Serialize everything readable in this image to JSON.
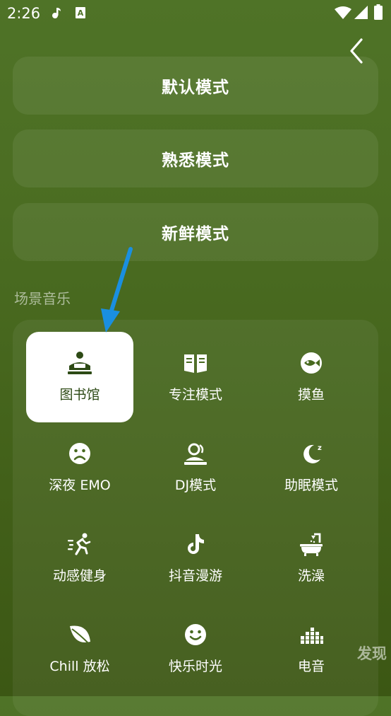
{
  "status_bar": {
    "time": "2:26",
    "icons": [
      "music-note-icon",
      "a-notification-icon",
      "wifi-icon",
      "signal-icon",
      "battery-icon"
    ]
  },
  "header": {
    "back_icon": "chevron-left-icon"
  },
  "modes": [
    {
      "label": "默认模式"
    },
    {
      "label": "熟悉模式"
    },
    {
      "label": "新鲜模式"
    }
  ],
  "section_title": "场景音乐",
  "scenes": [
    {
      "label": "图书馆",
      "icon": "library-icon",
      "selected": true
    },
    {
      "label": "专注模式",
      "icon": "book-icon"
    },
    {
      "label": "摸鱼",
      "icon": "fish-icon"
    },
    {
      "label": "深夜 EMO",
      "icon": "sad-face-icon"
    },
    {
      "label": "DJ模式",
      "icon": "dj-icon"
    },
    {
      "label": "助眠模式",
      "icon": "moon-sleep-icon"
    },
    {
      "label": "动感健身",
      "icon": "running-icon"
    },
    {
      "label": "抖音漫游",
      "icon": "tiktok-icon"
    },
    {
      "label": "洗澡",
      "icon": "bathtub-icon"
    },
    {
      "label": "Chill 放松",
      "icon": "leaf-icon"
    },
    {
      "label": "快乐时光",
      "icon": "smile-icon"
    },
    {
      "label": "电音",
      "icon": "equalizer-icon"
    }
  ],
  "discover_label": "发现",
  "colors": {
    "accent_dark": "#2d4a15",
    "annotation_arrow": "#1a8fe0"
  }
}
